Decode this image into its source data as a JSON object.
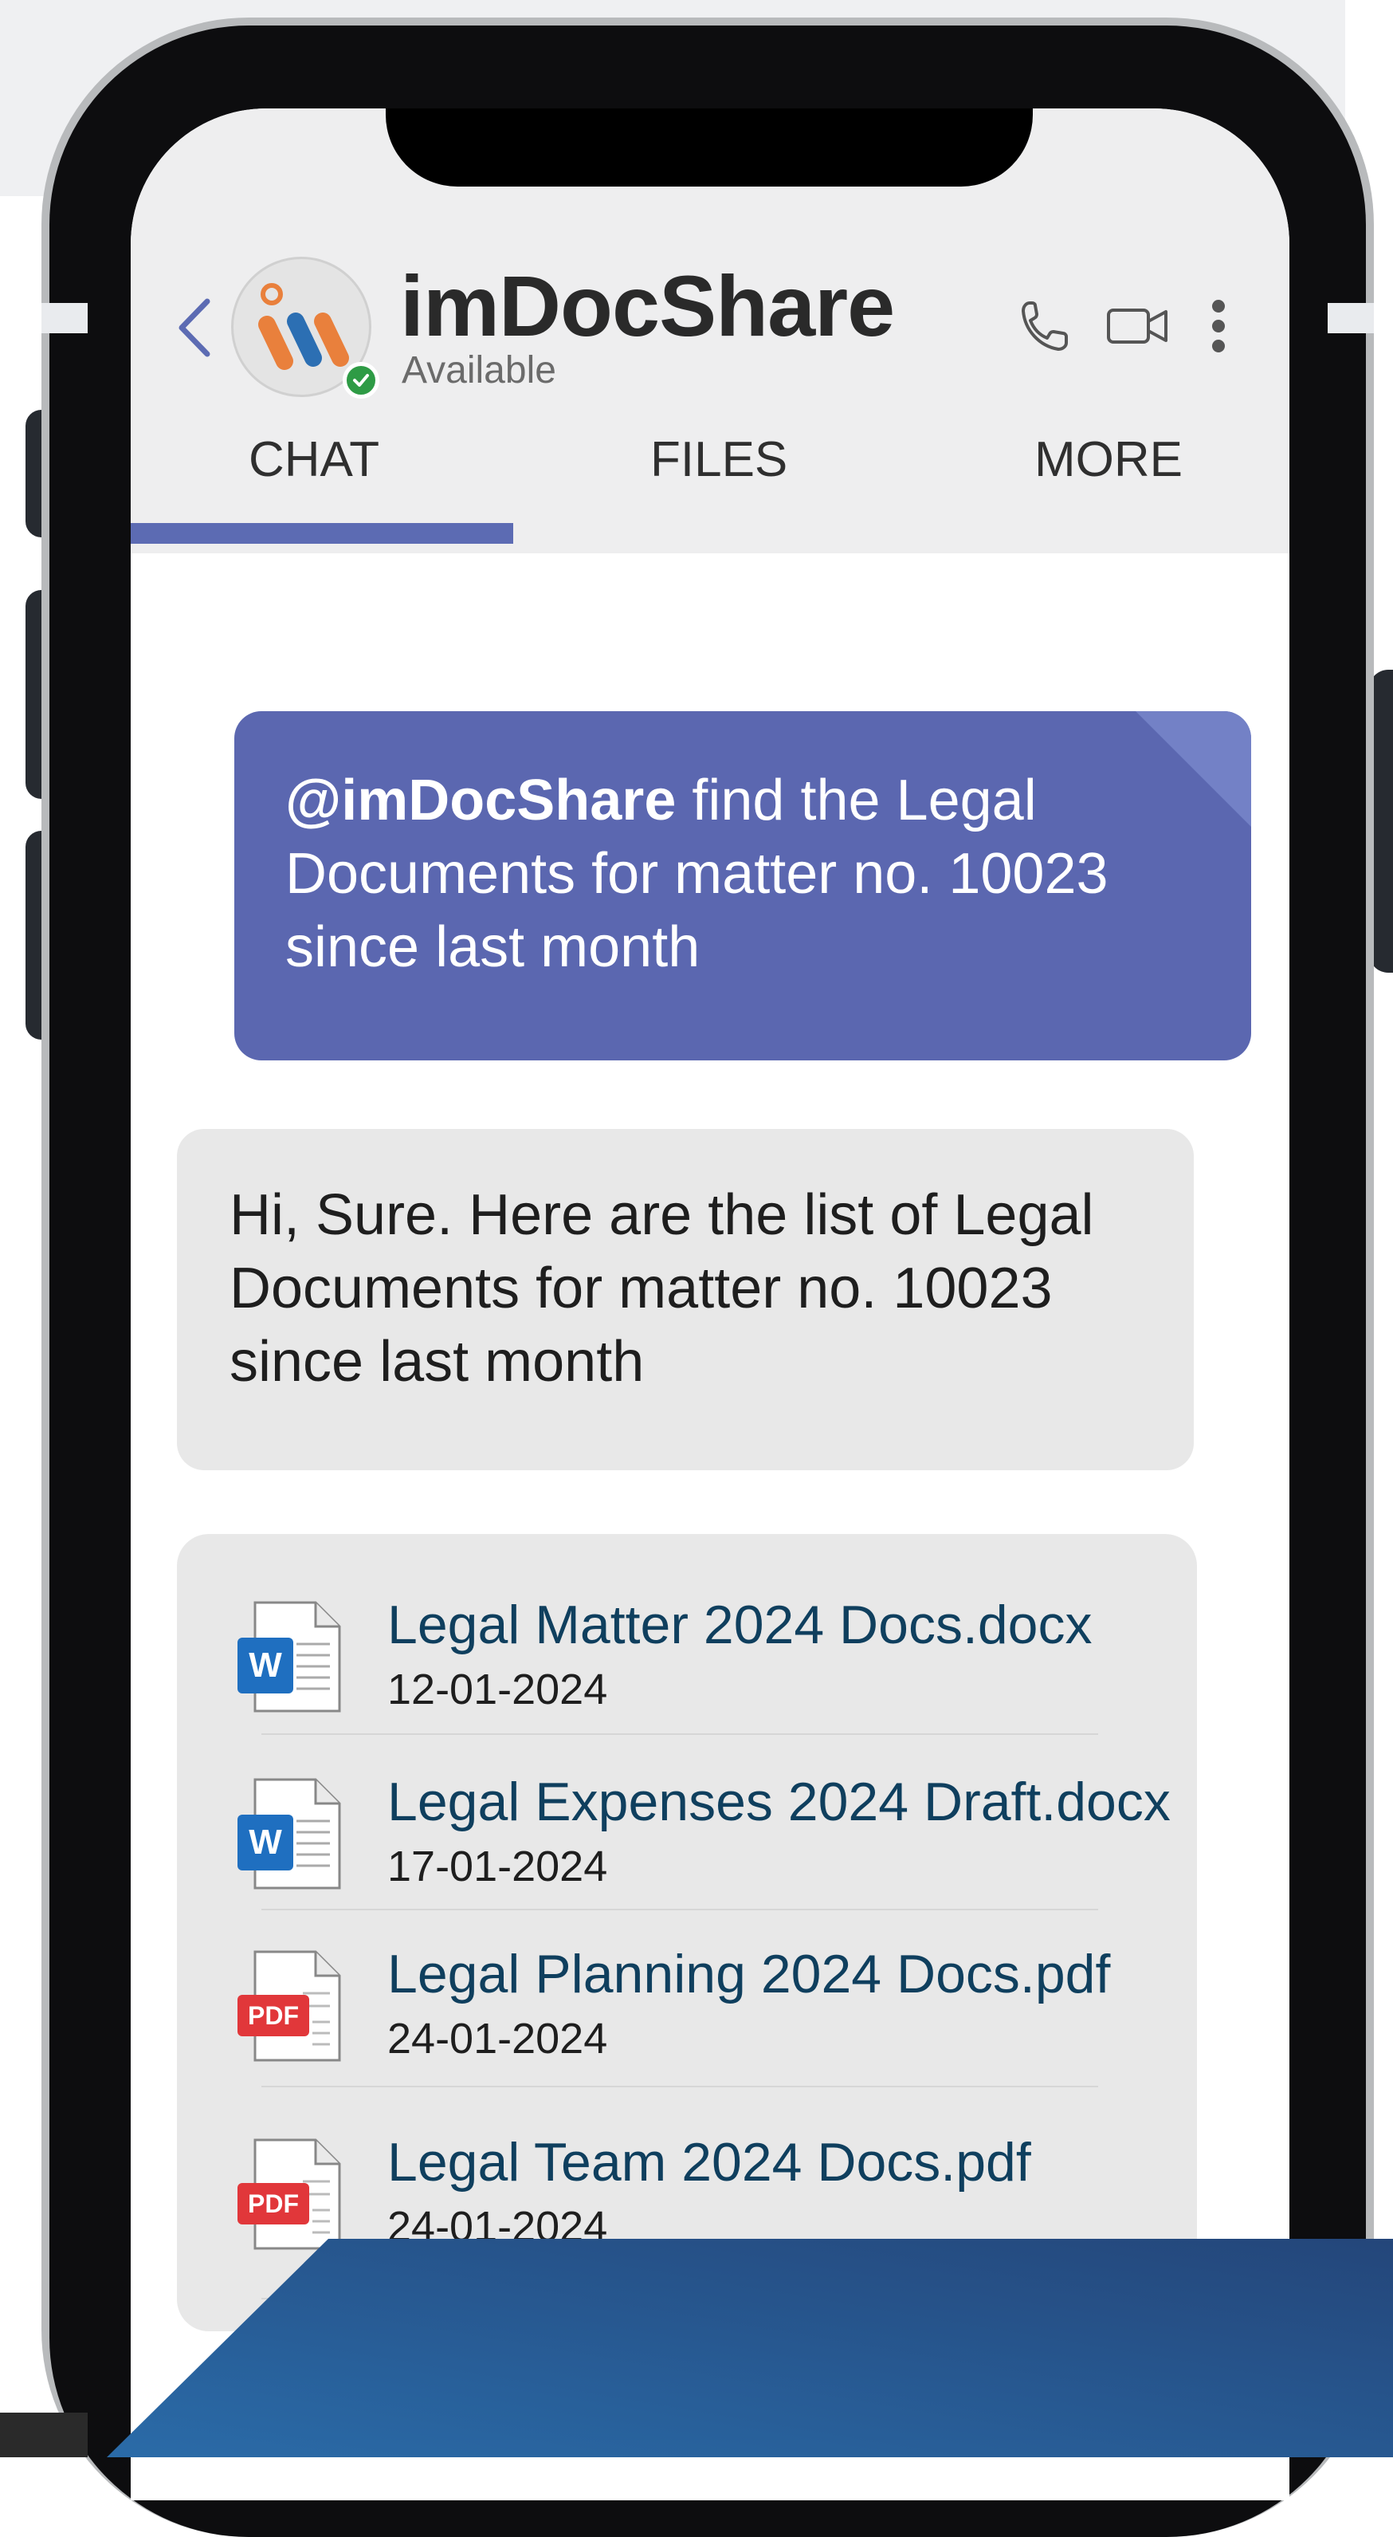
{
  "app": {
    "title": "imDocShare",
    "status": "Available"
  },
  "header_icons": {
    "back": "chevron-left-icon",
    "call": "phone-icon",
    "video": "video-camera-icon",
    "more": "more-vertical-icon"
  },
  "tabs": [
    {
      "label": "CHAT",
      "active": true
    },
    {
      "label": "FILES",
      "active": false
    },
    {
      "label": "MORE",
      "active": false
    }
  ],
  "messages": {
    "outgoing": {
      "mention": "@imDocShare",
      "text": " find the Legal Documents for matter no. 10023 since last month"
    },
    "incoming": {
      "text": "Hi, Sure. Here are the list of Legal Documents for matter no. 10023 since last month"
    }
  },
  "files": [
    {
      "name": "Legal Matter 2024 Docs.docx",
      "date": "12-01-2024",
      "type": "word",
      "badge": "W"
    },
    {
      "name": "Legal Expenses 2024 Draft.docx",
      "date": "17-01-2024",
      "type": "word",
      "badge": "W"
    },
    {
      "name": "Legal Planning 2024 Docs.pdf",
      "date": "24-01-2024",
      "type": "pdf",
      "badge": "PDF"
    },
    {
      "name": "Legal Team 2024 Docs.pdf",
      "date": "24-01-2024",
      "type": "pdf",
      "badge": "PDF"
    }
  ],
  "colors": {
    "accent": "#5b67b0",
    "tab_underline": "#5c6bb3",
    "file_link": "#0f3f5e",
    "presence": "#2e9b45",
    "word_blue": "#1f6fc0",
    "pdf_red": "#e1373a",
    "corner_gradient_start": "#2a6ba8",
    "corner_gradient_end": "#24467a"
  }
}
